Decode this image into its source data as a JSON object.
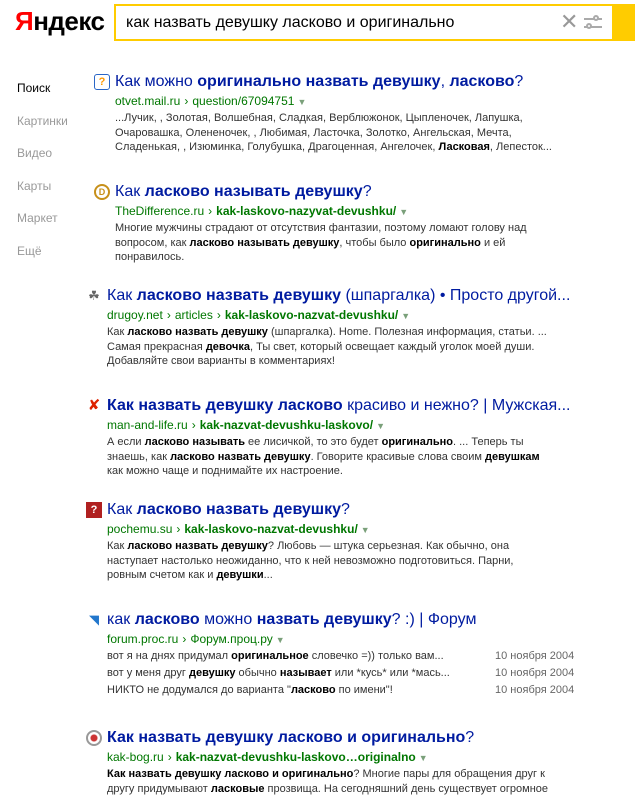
{
  "header": {
    "logo_first": "Я",
    "logo_rest": "ндекс",
    "query": "как назвать девушку ласково и оригинально",
    "clear_glyph": "✕"
  },
  "sidenav": {
    "items": [
      {
        "label": "Поиск",
        "active": true
      },
      {
        "label": "Картинки"
      },
      {
        "label": "Видео"
      },
      {
        "label": "Карты"
      },
      {
        "label": "Маркет"
      },
      {
        "label": "Ещё"
      }
    ]
  },
  "results": [
    {
      "icon": "mail-answers-icon",
      "icon_glyph": "?",
      "title": [
        [
          "Как можно ",
          false
        ],
        [
          "оригинально назвать девушку",
          true
        ],
        [
          ", ",
          false
        ],
        [
          "ласково",
          true
        ],
        [
          "?",
          false
        ]
      ],
      "url_host": "otvet.mail.ru",
      "url_path": [
        [
          "question/67094751",
          false
        ]
      ],
      "snippet": [
        [
          [
            "...Лучик, , Золотая, Волшебная, Сладкая, Верблюжонок, Цыпленочек, Лапушка,",
            false
          ]
        ],
        [
          [
            "Очаровашка, Олененочек, , Любимая, Ласточка, Золотко, Ангельская, Мечта,",
            false
          ]
        ],
        [
          [
            "Сладенькая, , Изюминка, Голубушка, Драгоценная, Ангелочек, ",
            false
          ],
          [
            "Ласковая",
            true
          ],
          [
            ", Лепесток...",
            false
          ]
        ]
      ]
    },
    {
      "icon": "thedifference-icon",
      "icon_glyph": "D",
      "title": [
        [
          "Как ",
          false
        ],
        [
          "ласково называть девушку",
          true
        ],
        [
          "?",
          false
        ]
      ],
      "url_host": "TheDifference.ru",
      "url_path": [
        [
          "kak-laskovo-nazyvat-devushku/",
          true
        ]
      ],
      "snippet": [
        [
          [
            "Многие мужчины страдают от отсутствия фантазии, поэтому ломают голову над",
            false
          ]
        ],
        [
          [
            "вопросом, как ",
            false
          ],
          [
            "ласково называть девушку",
            true
          ],
          [
            ", чтобы было ",
            false
          ],
          [
            "оригинально",
            true
          ],
          [
            " и ей",
            false
          ]
        ],
        [
          [
            "понравилось.",
            false
          ]
        ]
      ]
    },
    {
      "icon": "drugoy-icon",
      "icon_glyph": "☘",
      "title": [
        [
          "Как ",
          false
        ],
        [
          "ласково назвать девушку",
          true
        ],
        [
          " (шпаргалка) • Просто другой...",
          false
        ]
      ],
      "url_host": "drugoy.net",
      "url_path": [
        [
          "articles",
          false
        ],
        [
          "kak-laskovo-nazvat-devushku/",
          true
        ]
      ],
      "snippet": [
        [
          [
            "Как ",
            false
          ],
          [
            "ласково назвать девушку",
            true
          ],
          [
            " (шпаргалка). Home. Полезная информация, статьи. ...",
            false
          ]
        ],
        [
          [
            "Самая прекрасная ",
            false
          ],
          [
            "девочка",
            true
          ],
          [
            ", Ты свет, который освещает каждый уголок моей души.",
            false
          ]
        ],
        [
          [
            "Добавляйте свои варианты в комментариях!",
            false
          ]
        ]
      ]
    },
    {
      "icon": "man-and-life-icon",
      "icon_glyph": "✘",
      "title": [
        [
          "Как назвать девушку ласково",
          true
        ],
        [
          " красиво и нежно? | Мужская...",
          false
        ]
      ],
      "url_host": "man-and-life.ru",
      "url_path": [
        [
          "kak-nazvat-devushku-laskovo/",
          true
        ]
      ],
      "snippet": [
        [
          [
            "А если ",
            false
          ],
          [
            "ласково называть",
            true
          ],
          [
            " ее лисичкой, то это будет ",
            false
          ],
          [
            "оригинально",
            true
          ],
          [
            ". ... Теперь ты",
            false
          ]
        ],
        [
          [
            "знаешь, как ",
            false
          ],
          [
            "ласково назвать девушку",
            true
          ],
          [
            ". Говорите красивые слова своим ",
            false
          ],
          [
            "девушкам",
            true
          ]
        ],
        [
          [
            "как можно чаще и поднимайте их настроение.",
            false
          ]
        ]
      ]
    },
    {
      "icon": "pochemu-icon",
      "icon_glyph": "?",
      "title": [
        [
          "Как ",
          false
        ],
        [
          "ласково назвать девушку",
          true
        ],
        [
          "?",
          false
        ]
      ],
      "url_host": "pochemu.su",
      "url_path": [
        [
          "kak-laskovo-nazvat-devushku/",
          true
        ]
      ],
      "snippet": [
        [
          [
            "Как ",
            false
          ],
          [
            "ласково назвать девушку",
            true
          ],
          [
            "? Любовь — штука серьезная. Как обычно, она",
            false
          ]
        ],
        [
          [
            "наступает настолько неожиданно, что к ней невозможно подготовиться. Парни,",
            false
          ]
        ],
        [
          [
            "ровным счетом как и ",
            false
          ],
          [
            "девушки",
            true
          ],
          [
            "...",
            false
          ]
        ]
      ]
    },
    {
      "icon": "forum-proc-icon",
      "icon_glyph": "◥",
      "title": [
        [
          "как ",
          false
        ],
        [
          "ласково",
          true
        ],
        [
          " можно ",
          false
        ],
        [
          "назвать девушку",
          true
        ],
        [
          "? :) | Форум",
          false
        ]
      ],
      "url_host": "forum.proc.ru",
      "url_path": [
        [
          "Форум.проц.ру",
          false
        ]
      ],
      "forum_rows": [
        {
          "text": [
            [
              "вот я на днях придумал ",
              false
            ],
            [
              "оригинальное",
              true
            ],
            [
              " словечко =)) только вам...",
              false
            ]
          ],
          "date": "10 ноября 2004"
        },
        {
          "text": [
            [
              "вот у меня друг ",
              false
            ],
            [
              "девушку",
              true
            ],
            [
              " обычно ",
              false
            ],
            [
              "называет",
              true
            ],
            [
              " или *кусь* или *мась...",
              false
            ]
          ],
          "date": "10 ноября 2004"
        },
        {
          "text": [
            [
              "НИКТО не додумался до варианта \"",
              false
            ],
            [
              "ласково",
              true
            ],
            [
              " по имени\"!",
              false
            ]
          ],
          "date": "10 ноября 2004"
        }
      ]
    },
    {
      "icon": "kak-bog-icon",
      "icon_glyph": "",
      "title": [
        [
          "Как назвать девушку ласково и оригинально",
          true
        ],
        [
          "?",
          false
        ]
      ],
      "url_host": "kak-bog.ru",
      "url_path": [
        [
          "kak-nazvat-devushku-laskovo…originalno",
          true
        ]
      ],
      "snippet": [
        [
          [
            "Как назвать девушку ласково и оригинально",
            true
          ],
          [
            "? Многие пары для обращения друг к",
            false
          ]
        ],
        [
          [
            "другу придумывают ",
            false
          ],
          [
            "ласковые",
            true
          ],
          [
            " прозвища. На сегодняшний день существует огромное",
            false
          ]
        ]
      ]
    }
  ],
  "colors": {
    "title_link": "#001ba0",
    "url_green": "#007700",
    "accent_yellow": "#ffcc00",
    "logo_red": "#ff0000"
  }
}
